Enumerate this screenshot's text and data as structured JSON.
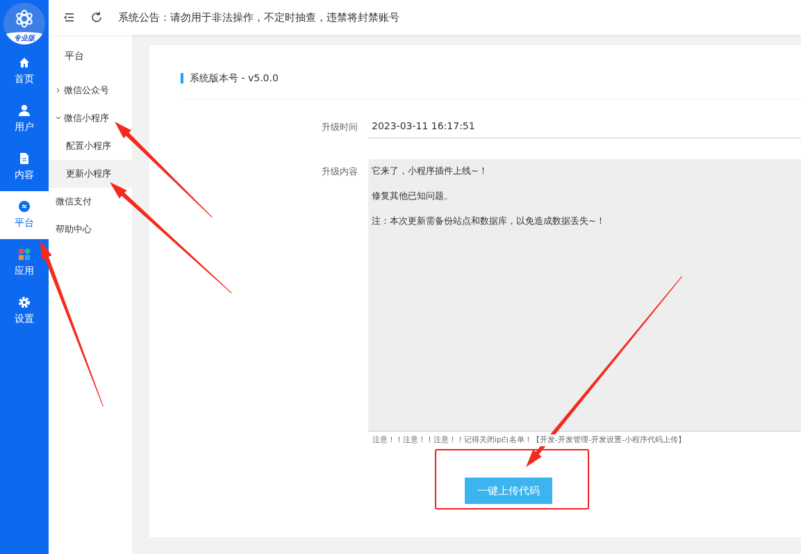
{
  "logo": {
    "badge": "专业版"
  },
  "rail": [
    {
      "label": "首页",
      "selected": false
    },
    {
      "label": "用户",
      "selected": false
    },
    {
      "label": "内容",
      "selected": false
    },
    {
      "label": "平台",
      "selected": true
    },
    {
      "label": "应用",
      "selected": false
    },
    {
      "label": "设置",
      "selected": false
    }
  ],
  "topbar": {
    "notice": "系统公告：请勿用于非法操作，不定时抽查，违禁将封禁账号"
  },
  "subnav": {
    "title": "平台",
    "items": [
      {
        "label": "微信公众号",
        "expanded": false,
        "selected": false
      },
      {
        "label": "微信小程序",
        "expanded": true,
        "selected": false,
        "children": [
          {
            "label": "配置小程序",
            "selected": false
          },
          {
            "label": "更新小程序",
            "selected": true
          }
        ]
      },
      {
        "label": "微信支付",
        "selected": false
      },
      {
        "label": "帮助中心",
        "selected": false
      }
    ]
  },
  "panel": {
    "title": "系统版本号 - v5.0.0",
    "fields": [
      {
        "kind": "input",
        "label": "升级时间",
        "value": "2023-03-11 16:17:51"
      },
      {
        "kind": "textarea",
        "label": "升级内容",
        "paragraphs": [
          "它来了，小程序插件上线~！",
          "修复其他已知问题。",
          "注：本次更新需备份站点和数据库，以免造成数据丢失~！"
        ]
      }
    ],
    "warning": "注意！！注意！！注意！！记得关闭ip白名单！【开发-开发管理-开发设置-小程序代码上传】",
    "button": "一键上传代码"
  }
}
